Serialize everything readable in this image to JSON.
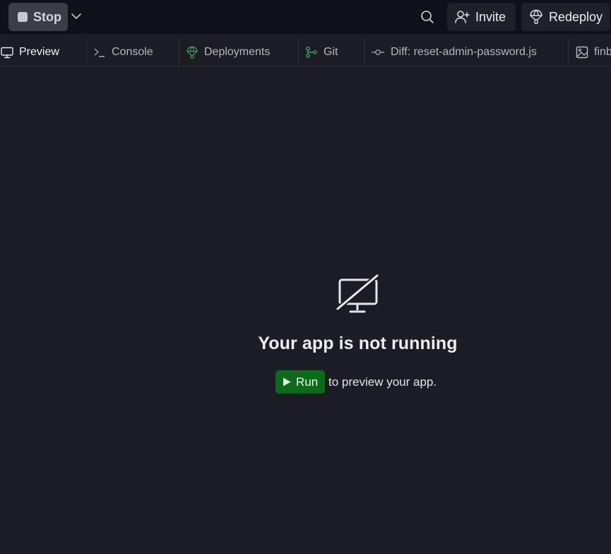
{
  "topbar": {
    "stop_label": "Stop",
    "invite_label": "Invite",
    "redeploy_label": "Redeploy"
  },
  "icons": {
    "stop": "stop-square-icon",
    "dropdown": "chevron-down-icon",
    "search": "search-icon",
    "invite": "person-add-icon",
    "redeploy": "balloon-icon",
    "preview": "monitor-icon",
    "console": "terminal-icon",
    "deployments": "balloon-icon",
    "git": "git-branch-icon",
    "diff": "commit-icon",
    "image": "image-icon",
    "not_running": "monitor-off-icon",
    "run": "play-icon"
  },
  "tabs": [
    {
      "label": "Preview",
      "active": true
    },
    {
      "label": "Console",
      "active": false
    },
    {
      "label": "Deployments",
      "active": false
    },
    {
      "label": "Git",
      "active": false
    },
    {
      "label": "Diff: reset-admin-password.js",
      "active": false
    },
    {
      "label": "finb",
      "active": false
    }
  ],
  "main": {
    "title": "Your app is not running",
    "run_label": "Run",
    "run_suffix": "to preview your app."
  },
  "colors": {
    "background": "#1c1d24",
    "topbar": "#0e1117",
    "run_button": "#0e6a1a",
    "deployments_icon": "#3fa35a",
    "git_icon": "#3fa35a"
  }
}
